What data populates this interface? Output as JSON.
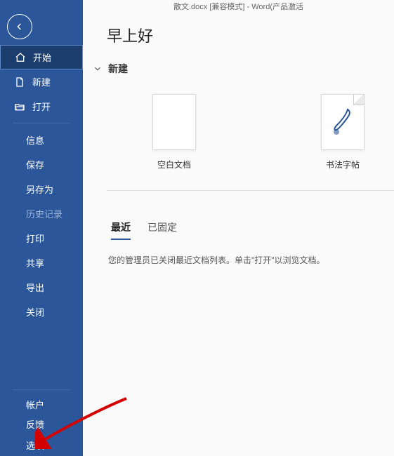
{
  "titlebar": "散文.docx [兼容模式] - Word(产品激活",
  "greeting": "早上好",
  "sidebar": {
    "primary": [
      {
        "name": "home",
        "label": "开始",
        "icon": "home",
        "active": true
      },
      {
        "name": "new",
        "label": "新建",
        "icon": "page",
        "active": false
      },
      {
        "name": "open",
        "label": "打开",
        "icon": "folder",
        "active": false
      }
    ],
    "secondary": [
      {
        "name": "info",
        "label": "信息",
        "disabled": false
      },
      {
        "name": "save",
        "label": "保存",
        "disabled": false
      },
      {
        "name": "saveas",
        "label": "另存为",
        "disabled": false
      },
      {
        "name": "history",
        "label": "历史记录",
        "disabled": true
      },
      {
        "name": "print",
        "label": "打印",
        "disabled": false
      },
      {
        "name": "share",
        "label": "共享",
        "disabled": false
      },
      {
        "name": "export",
        "label": "导出",
        "disabled": false
      },
      {
        "name": "close",
        "label": "关闭",
        "disabled": false
      }
    ],
    "footer": [
      {
        "name": "account",
        "label": "帐户"
      },
      {
        "name": "feedback",
        "label": "反馈"
      },
      {
        "name": "options",
        "label": "选项"
      }
    ]
  },
  "section_new": {
    "label": "新建"
  },
  "templates": [
    {
      "name": "blank",
      "caption": "空白文档"
    },
    {
      "name": "calligraphy",
      "caption": "书法字帖"
    }
  ],
  "tabs": [
    {
      "name": "recent",
      "label": "最近",
      "active": true
    },
    {
      "name": "pinned",
      "label": "已固定",
      "active": false
    }
  ],
  "empty_message": "您的管理员已关闭最近文档列表。单击\"打开\"以浏览文档。"
}
